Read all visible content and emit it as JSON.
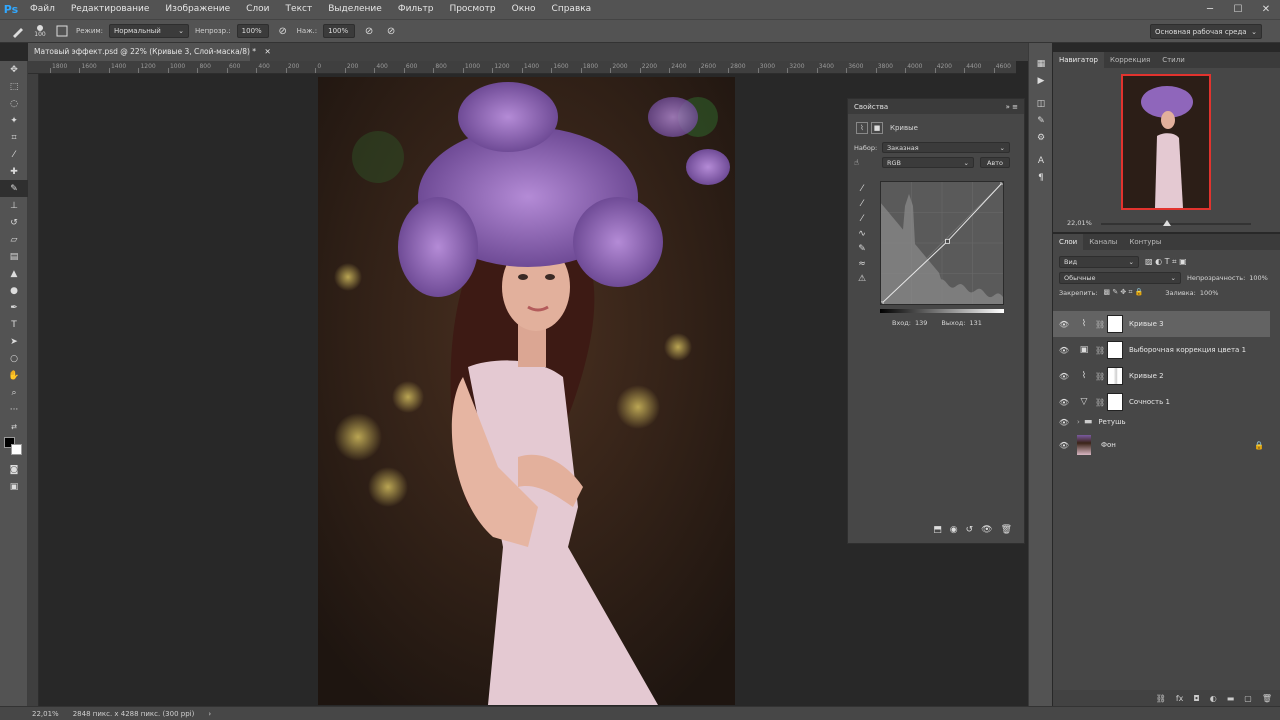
{
  "menu": [
    "Файл",
    "Редактирование",
    "Изображение",
    "Слои",
    "Текст",
    "Выделение",
    "Фильтр",
    "Просмотр",
    "Окно",
    "Справка"
  ],
  "options": {
    "brush_size": "100",
    "mode_label": "Режим:",
    "mode_value": "Нормальный",
    "opacity_label": "Непрозр.:",
    "opacity_value": "100%",
    "flow_label": "Наж.:",
    "flow_value": "100%",
    "workspace": "Основная рабочая среда"
  },
  "document_tab": "Матовый эффект.psd @ 22% (Кривые 3, Слой-маска/8) *",
  "ruler_labels": [
    "1800",
    "1600",
    "1400",
    "1200",
    "1000",
    "800",
    "600",
    "400",
    "200",
    "0",
    "200",
    "400",
    "600",
    "800",
    "1000",
    "1200",
    "1400",
    "1600",
    "1800",
    "2000",
    "2200",
    "2400",
    "2600",
    "2800",
    "3000",
    "3200",
    "3400",
    "3600",
    "3800",
    "4000",
    "4200",
    "4400",
    "4600"
  ],
  "properties": {
    "title": "Свойства",
    "adjustment_name": "Кривые",
    "preset_label": "Набор:",
    "preset_value": "Заказная",
    "channel_value": "RGB",
    "auto_button": "Авто",
    "input_label": "Вход:",
    "input_value": "139",
    "output_label": "Выход:",
    "output_value": "131"
  },
  "navigator": {
    "tabs": [
      "Навигатор",
      "Коррекция",
      "Стили"
    ],
    "zoom": "22,01%"
  },
  "layers": {
    "tabs": [
      "Слои",
      "Каналы",
      "Контуры"
    ],
    "filter_kind": "Вид",
    "blend_mode": "Обычные",
    "opacity_label": "Непрозрачность:",
    "opacity_value": "100%",
    "lock_label": "Закрепить:",
    "fill_label": "Заливка:",
    "fill_value": "100%",
    "items": [
      {
        "name": "Кривые 3",
        "type": "curves",
        "selected": true
      },
      {
        "name": "Выборочная коррекция цвета 1",
        "type": "selective",
        "selected": false
      },
      {
        "name": "Кривые 2",
        "type": "curves",
        "selected": false
      },
      {
        "name": "Сочность 1",
        "type": "vibrance",
        "selected": false
      },
      {
        "name": "Ретушь",
        "type": "group",
        "selected": false
      },
      {
        "name": "Фон",
        "type": "background",
        "selected": false
      }
    ]
  },
  "status": {
    "zoom": "22,01%",
    "doc_info": "2848 пикс. x 4288 пикс. (300 ppi)"
  },
  "curve": {
    "points": [
      [
        0,
        0
      ],
      [
        139,
        131
      ],
      [
        255,
        255
      ]
    ]
  }
}
